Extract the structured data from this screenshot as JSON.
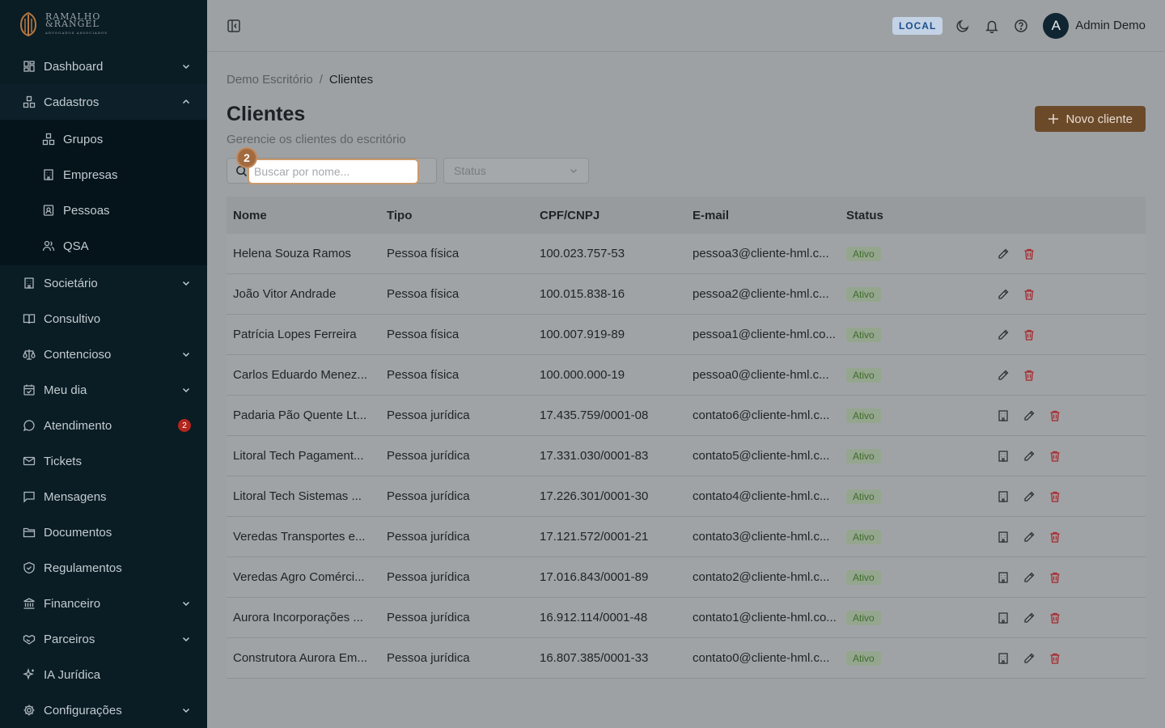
{
  "brand": {
    "line1": "RAMALHO",
    "line2": "&RANGEL",
    "line3": "ADVOGADOS ASSOCIADOS"
  },
  "sidebar": {
    "items": [
      {
        "label": "Dashboard",
        "icon": "dashboard-icon",
        "expandable": true
      },
      {
        "label": "Cadastros",
        "icon": "cadastros-icon",
        "expandable": true,
        "open": true
      },
      {
        "label": "Societário",
        "icon": "building-icon",
        "expandable": true
      },
      {
        "label": "Consultivo",
        "icon": "book-icon",
        "expandable": false
      },
      {
        "label": "Contencioso",
        "icon": "scale-icon",
        "expandable": true
      },
      {
        "label": "Meu dia",
        "icon": "calendar-icon",
        "expandable": true
      },
      {
        "label": "Atendimento",
        "icon": "chat-icon",
        "expandable": false,
        "badge": "2"
      },
      {
        "label": "Tickets",
        "icon": "ticket-icon",
        "expandable": false
      },
      {
        "label": "Mensagens",
        "icon": "message-icon",
        "expandable": false
      },
      {
        "label": "Documentos",
        "icon": "folder-icon",
        "expandable": false
      },
      {
        "label": "Regulamentos",
        "icon": "shield-icon",
        "expandable": false
      },
      {
        "label": "Financeiro",
        "icon": "bank-icon",
        "expandable": true
      },
      {
        "label": "Parceiros",
        "icon": "handshake-icon",
        "expandable": true
      },
      {
        "label": "IA Jurídica",
        "icon": "sparkles-icon",
        "expandable": false
      },
      {
        "label": "Configurações",
        "icon": "gear-icon",
        "expandable": true
      }
    ],
    "subitems": [
      {
        "label": "Grupos",
        "icon": "groups-icon"
      },
      {
        "label": "Empresas",
        "icon": "building-icon"
      },
      {
        "label": "Pessoas",
        "icon": "contact-icon"
      },
      {
        "label": "QSA",
        "icon": "user-group-icon"
      }
    ]
  },
  "topbar": {
    "env": "LOCAL",
    "user_initial": "A",
    "user_name": "Admin Demo"
  },
  "breadcrumb": {
    "root": "Demo Escritório",
    "sep": "/",
    "current": "Clientes"
  },
  "page": {
    "title": "Clientes",
    "subtitle": "Gerencie os clientes do escritório",
    "new_button": "Novo cliente"
  },
  "filters": {
    "search_placeholder": "Buscar por nome...",
    "status_placeholder": "Status",
    "step": "2"
  },
  "table": {
    "headers": {
      "nome": "Nome",
      "tipo": "Tipo",
      "doc": "CPF/CNPJ",
      "email": "E-mail",
      "status": "Status"
    },
    "rows": [
      {
        "nome": "Helena Souza Ramos",
        "tipo": "Pessoa física",
        "doc": "100.023.757-53",
        "email": "pessoa3@cliente-hml.c...",
        "status": "Ativo",
        "juridica": false
      },
      {
        "nome": "João Vitor Andrade",
        "tipo": "Pessoa física",
        "doc": "100.015.838-16",
        "email": "pessoa2@cliente-hml.c...",
        "status": "Ativo",
        "juridica": false
      },
      {
        "nome": "Patrícia Lopes Ferreira",
        "tipo": "Pessoa física",
        "doc": "100.007.919-89",
        "email": "pessoa1@cliente-hml.co...",
        "status": "Ativo",
        "juridica": false
      },
      {
        "nome": "Carlos Eduardo Menez...",
        "tipo": "Pessoa física",
        "doc": "100.000.000-19",
        "email": "pessoa0@cliente-hml.c...",
        "status": "Ativo",
        "juridica": false
      },
      {
        "nome": "Padaria Pão Quente Lt...",
        "tipo": "Pessoa jurídica",
        "doc": "17.435.759/0001-08",
        "email": "contato6@cliente-hml.c...",
        "status": "Ativo",
        "juridica": true
      },
      {
        "nome": "Litoral Tech Pagament...",
        "tipo": "Pessoa jurídica",
        "doc": "17.331.030/0001-83",
        "email": "contato5@cliente-hml.c...",
        "status": "Ativo",
        "juridica": true
      },
      {
        "nome": "Litoral Tech Sistemas ...",
        "tipo": "Pessoa jurídica",
        "doc": "17.226.301/0001-30",
        "email": "contato4@cliente-hml.c...",
        "status": "Ativo",
        "juridica": true
      },
      {
        "nome": "Veredas Transportes e...",
        "tipo": "Pessoa jurídica",
        "doc": "17.121.572/0001-21",
        "email": "contato3@cliente-hml.c...",
        "status": "Ativo",
        "juridica": true
      },
      {
        "nome": "Veredas Agro Comérci...",
        "tipo": "Pessoa jurídica",
        "doc": "17.016.843/0001-89",
        "email": "contato2@cliente-hml.c...",
        "status": "Ativo",
        "juridica": true
      },
      {
        "nome": "Aurora Incorporações ...",
        "tipo": "Pessoa jurídica",
        "doc": "16.912.114/0001-48",
        "email": "contato1@cliente-hml.co...",
        "status": "Ativo",
        "juridica": true
      },
      {
        "nome": "Construtora Aurora Em...",
        "tipo": "Pessoa jurídica",
        "doc": "16.807.385/0001-33",
        "email": "contato0@cliente-hml.c...",
        "status": "Ativo",
        "juridica": true
      }
    ]
  }
}
